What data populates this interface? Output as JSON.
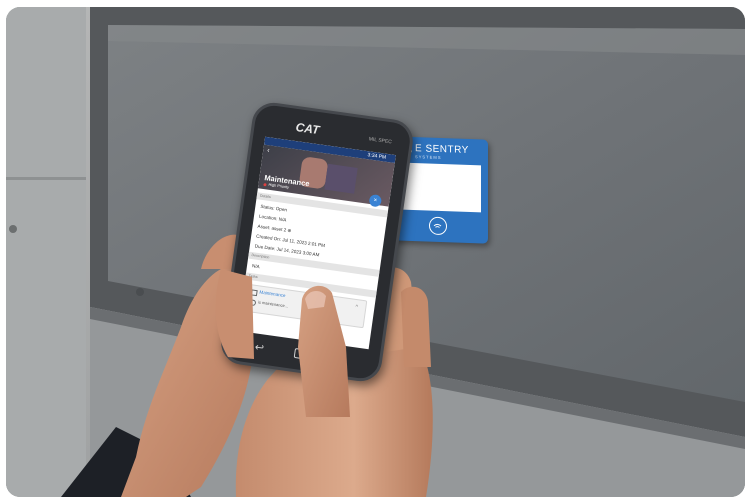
{
  "phone": {
    "brand": "CAT",
    "model_label": "MIL SPEC",
    "status_time": "3:34 PM"
  },
  "app": {
    "title": "Maintenance",
    "priority": "High Priority",
    "section_details": "Details",
    "status": "Status: Open",
    "location": "Location: N/A",
    "asset": "Asset: asset 2 ⊕",
    "created_on": "Created On: Jul 11, 2023 2:01 PM",
    "due_date": "Due Date: Jul 14, 2023 3:00 AM",
    "section_description": "Description",
    "description": "N/A",
    "section_tasks": "Tasks",
    "task_1": "Maintenance",
    "task_2": "is maintenance..."
  },
  "sign": {
    "brand_main": "E SENTRY",
    "brand_sub": "S Y S T E M S"
  },
  "colors": {
    "sign_blue": "#2d73bf",
    "app_accent": "#3a83d4",
    "phone_body": "#2a2c30"
  }
}
